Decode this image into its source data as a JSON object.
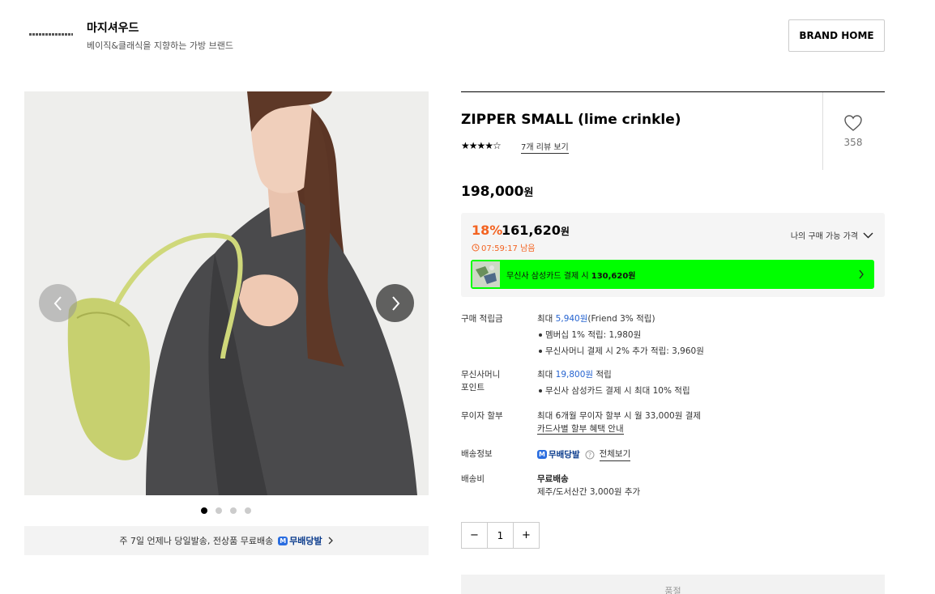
{
  "header": {
    "brand_name": "마지셔우드",
    "brand_desc": "베이직&클래식을 지향하는 가방 브랜드",
    "brand_home_label": "BRAND HOME"
  },
  "gallery": {
    "slide_count": 4,
    "active_slide": 1
  },
  "shipping_bar": {
    "text": "주 7일 언제나 당일발송, 전상품 무료배송",
    "badge_label": "무배당발",
    "badge_icon": "M"
  },
  "product": {
    "title": "ZIPPER SMALL (lime crinkle)",
    "rating_stars": "★★★★☆",
    "review_link": "7개 리뷰 보기",
    "like_count": "358",
    "original_price": "198,000",
    "currency": "원"
  },
  "price_box": {
    "discount_rate": "18%",
    "sale_price": "161,620",
    "currency": "원",
    "timer": "07:59:17 남음",
    "my_price_label": "나의 구매 가능 가격",
    "card_banner_text": "무신사 삼성카드 결제 시",
    "card_banner_price": "130,620원"
  },
  "benefits": {
    "points": {
      "label": "구매 적립금",
      "prefix": "최대",
      "amount": "5,940원",
      "suffix": "(Friend 3% 적립)",
      "items": [
        "멤버십 1% 적립: 1,980원",
        "무신사머니 결제 시 2% 추가 적립: 3,960원"
      ]
    },
    "money": {
      "label_line1": "무신사머니",
      "label_line2": "포인트",
      "prefix": "최대",
      "amount": "19,800원",
      "suffix": "적립",
      "items": [
        "무신사 삼성카드 결제 시 최대 10% 적립"
      ]
    },
    "installment": {
      "label": "무이자 할부",
      "text": "최대 6개월 무이자 할부 시 월 33,000원 결제",
      "link": "카드사별 할부 혜택 안내"
    },
    "delivery": {
      "label": "배송정보",
      "badge": "무배당발",
      "link": "전체보기"
    },
    "shipping_fee": {
      "label": "배송비",
      "value": "무료배송",
      "note": "제주/도서산간 3,000원 추가"
    }
  },
  "quantity": {
    "minus": "−",
    "value": "1",
    "plus": "+"
  },
  "buy_button": {
    "label": "품절"
  },
  "colors": {
    "accent_orange": "#f36321",
    "card_banner_green": "#00ff00",
    "link_blue": "#2563d0"
  }
}
